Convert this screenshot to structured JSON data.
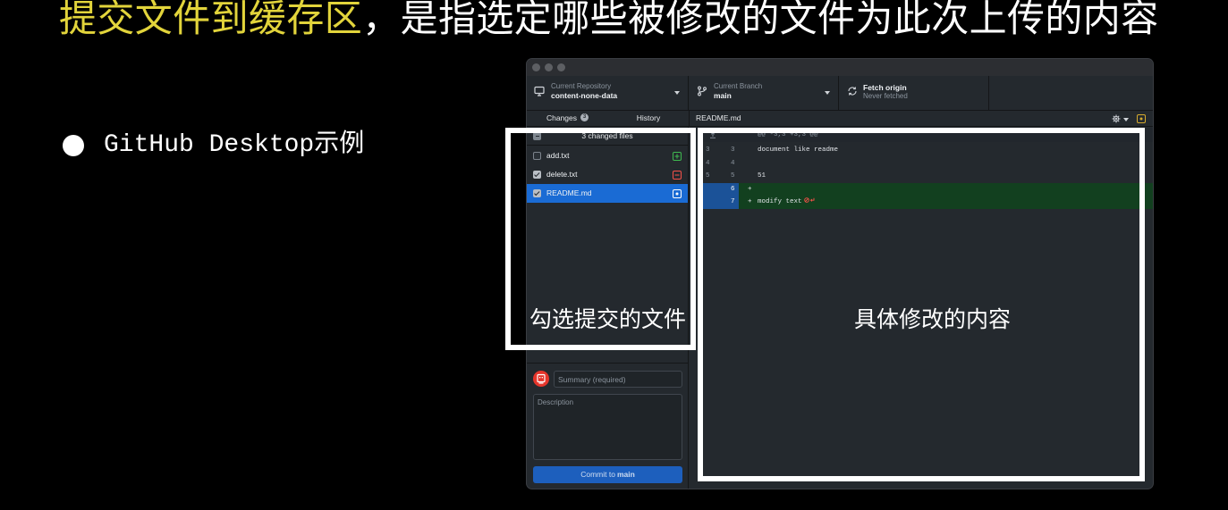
{
  "slide": {
    "title_highlight": "提交文件到缓存区",
    "title_rest": "，是指选定哪些被修改的文件为此次上传的内容",
    "bullet_text": "GitHub Desktop示例",
    "annotation_files": "勾选提交的文件",
    "annotation_diff": "具体修改的内容",
    "colors": {
      "background": "#000000",
      "text": "#ffffff",
      "title_highlight": "#e2d43b",
      "annotation": "#ffffff"
    }
  },
  "app": {
    "toolbar": {
      "repository": {
        "label": "Current Repository",
        "value": "content-none-data",
        "icon": "desktop-icon"
      },
      "branch": {
        "label": "Current Branch",
        "value": "main",
        "icon": "git-branch-icon"
      },
      "fetch": {
        "label": "Fetch origin",
        "status": "Never fetched",
        "icon": "sync-icon"
      }
    },
    "tabs": [
      {
        "label": "Changes",
        "badge": "3",
        "active": true
      },
      {
        "label": "History"
      }
    ],
    "changes": {
      "header": "3 changed files",
      "select_all_mixed": true,
      "files": [
        {
          "name": "add.txt",
          "checked": false,
          "status_icon": "file-added-icon"
        },
        {
          "name": "delete.txt",
          "checked": true,
          "status_icon": "file-removed-icon"
        },
        {
          "name": "README.md",
          "checked": true,
          "selected": true,
          "status_icon": "file-modified-icon"
        }
      ]
    },
    "commit": {
      "avatar_icon": "avatar-icon",
      "summary_placeholder": "Summary (required)",
      "description_placeholder": "Description",
      "button_prefix": "Commit to",
      "button_branch": "main"
    },
    "diff": {
      "file_name": "README.md",
      "settings_icon": "gear-icon",
      "file_status_icon": "file-modified-icon",
      "hunk_header": "@@ -3,3 +3,3 @@",
      "lines": [
        {
          "old": "3",
          "new": "3",
          "text": "document like readme"
        },
        {
          "old": "4",
          "new": "4"
        },
        {
          "old": "5",
          "new": "5",
          "text": "51"
        },
        {
          "new": "6",
          "marker": "+",
          "added": true
        },
        {
          "new": "7",
          "marker": "+",
          "text": "modify text",
          "added": true,
          "trailing_icon": "no-newline-icon"
        }
      ]
    },
    "colors": {
      "window_bg": "#24292e",
      "selected_row": "#1a6bd4",
      "commit_button": "#1d5fbd",
      "added": "#3fb950",
      "removed": "#f85149",
      "modified": "#d6ab2e",
      "diff_added_bg": "#12401f",
      "diff_selected_gutter": "#1b5298",
      "avatar": "#e5352b"
    }
  }
}
